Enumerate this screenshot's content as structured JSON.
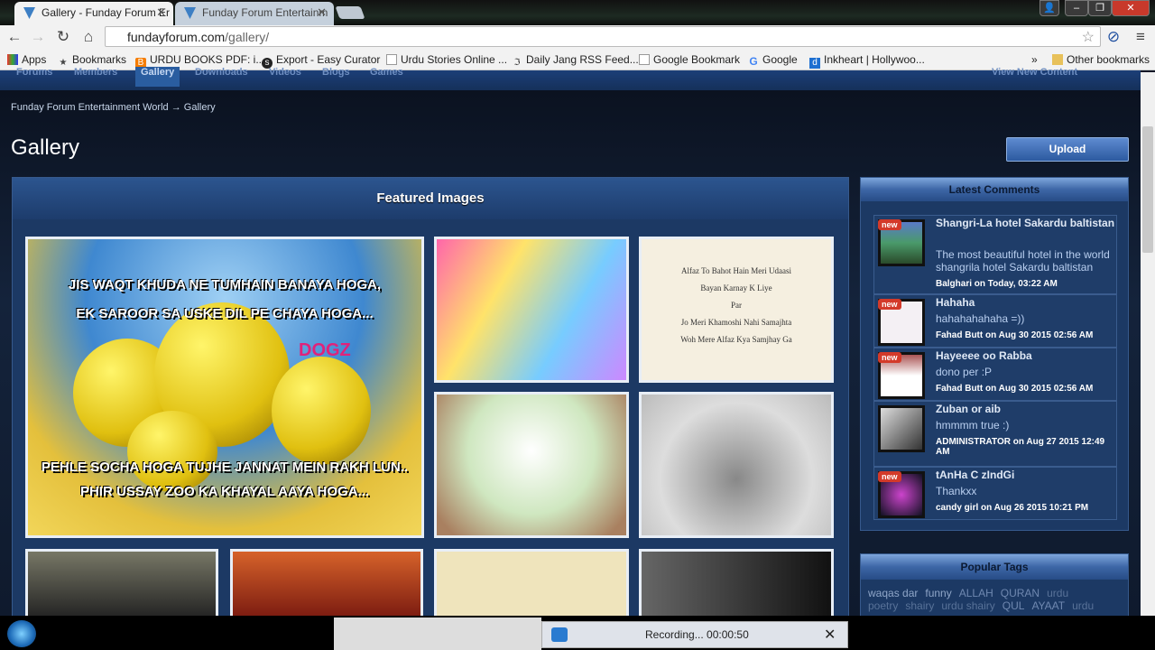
{
  "browser": {
    "tabs": [
      {
        "label": "Gallery - Funday Forum Er",
        "active": true
      },
      {
        "label": "Funday Forum Entertainm",
        "active": false
      }
    ],
    "url_host": "fundayforum.com",
    "url_path": "/gallery/",
    "bookmarks": [
      "Apps",
      "Bookmarks",
      "URDU BOOKS PDF: i...",
      "Export - Easy Curator",
      "Urdu Stories Online ...",
      "Daily Jang RSS Feed...",
      "Google Bookmark",
      "Google",
      "Inkheart | Hollywoo..."
    ],
    "more": "»",
    "other_bookmarks": "Other bookmarks"
  },
  "site_nav": {
    "items": [
      "Forums",
      "Members",
      "Gallery",
      "Downloads",
      "Videos",
      "Blogs",
      "Games"
    ],
    "right": "View New Content"
  },
  "breadcrumb": {
    "root": "Funday Forum Entertainment World",
    "sep": "→",
    "current": "Gallery"
  },
  "page_title": "Gallery",
  "upload_label": "Upload",
  "featured": {
    "title": "Featured Images",
    "big_caption_top": [
      "JIS WAQT KHUDA NE TUMHAIN BANAYA HOGA,",
      "EK SAROOR SA USKE DIL PE CHAYA HOGA..."
    ],
    "big_caption_bottom": [
      "PEHLE SOCHA HOGA TUJHE JANNAT MEIN RAKH LUN..",
      "PHIR USSAY ZOO KA KHAYAL AAYA HOGA..."
    ],
    "big_logo": "DOGZ",
    "diary_lines": [
      "Alfaz To Bahot Hain Meri Udaasi",
      "Bayan Karnay K Liye",
      "Par",
      "Jo Meri Khamoshi Nahi Samajhta",
      "Woh Mere Alfaz Kya Samjhay Ga"
    ]
  },
  "latest_comments": {
    "title": "Latest Comments",
    "items": [
      {
        "title": "Shangri-La hotel Sakardu baltistan",
        "body": "The most beautiful hotel in the world shangrila hotel Sakardu baltistan",
        "meta": "Balghari on Today, 03:22 AM",
        "new": "new"
      },
      {
        "title": "Hahaha",
        "body": "hahahahahaha =))",
        "meta": "Fahad Butt on Aug 30 2015 02:56 AM",
        "new": "new"
      },
      {
        "title": "Hayeeee oo Rabba",
        "body": "dono per :P",
        "meta": "Fahad Butt on Aug 30 2015 02:56 AM",
        "new": "new"
      },
      {
        "title": "Zuban or aib",
        "body": "hmmmm true :)",
        "meta": "ADMINISTRATOR on Aug 27 2015 12:49 AM",
        "new": null
      },
      {
        "title": "tAnHa C zIndGi",
        "body": "Thankxx",
        "meta": "candy girl on Aug 26 2015 10:21 PM",
        "new": "new"
      }
    ]
  },
  "popular_tags": {
    "title": "Popular Tags",
    "tags": [
      "waqas dar",
      "funny",
      "ALLAH",
      "QURAN",
      "urdu poetry",
      "shairy",
      "urdu shairy",
      "QUL",
      "AYAAT",
      "urdu"
    ]
  },
  "recording": {
    "label": "Recording... 00:00:50"
  }
}
